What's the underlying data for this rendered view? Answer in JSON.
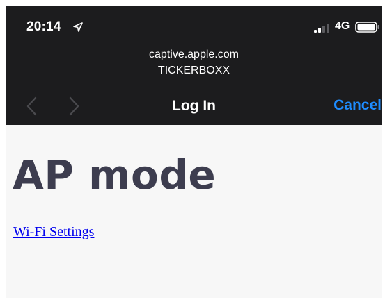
{
  "status_bar": {
    "time": "20:14",
    "network": "4G",
    "icons": [
      "location-arrow-icon",
      "cellular-signal-icon",
      "battery-icon"
    ]
  },
  "sheet": {
    "host": "captive.apple.com",
    "ssid": "TICKERBOXX",
    "title": "Log In",
    "cancel_label": "Cancel",
    "icons": [
      "chevron-left-icon",
      "chevron-right-icon"
    ]
  },
  "page": {
    "heading": "AP mode",
    "link_label": "Wi-Fi Settings"
  },
  "colors": {
    "header_bg": "#1c1c1e",
    "accent": "#1e8cff",
    "page_bg": "#f7f7f7",
    "heading": "#3d3d4f",
    "link": "#0000ee",
    "disabled_nav": "#4a4a4e"
  }
}
